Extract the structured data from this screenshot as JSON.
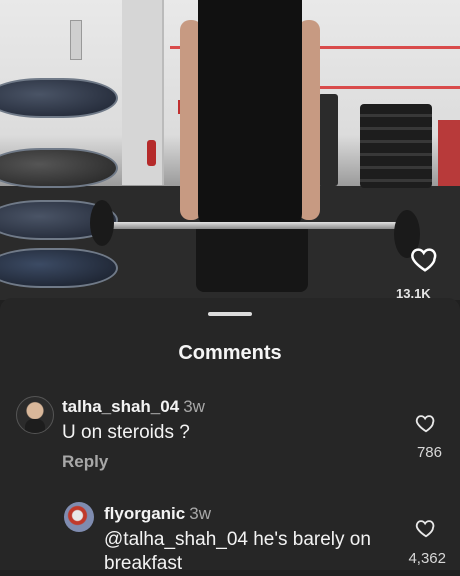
{
  "video": {
    "like_count": "13.1K"
  },
  "sheet": {
    "title": "Comments"
  },
  "comments": [
    {
      "username": "talha_shah_04",
      "time": "3w",
      "text": "U on steroids ?",
      "reply_label": "Reply",
      "likes": "786"
    },
    {
      "username": "flyorganic",
      "time": "3w",
      "text": "@talha_shah_04 he's barely on breakfast",
      "likes": "4,362"
    }
  ],
  "icons": {
    "video_like": "heart-outline-icon",
    "comment_like": "heart-outline-icon"
  }
}
